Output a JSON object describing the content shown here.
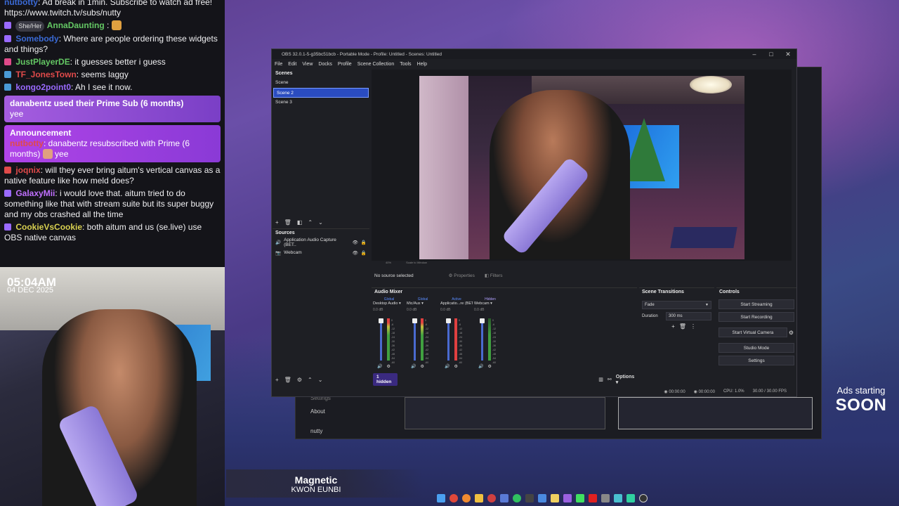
{
  "chat": {
    "top_partial": "Ad break in 1min. Subscribe to watch ad free! https://www.twitch.tv/subs/nutty",
    "top_partial_user": "nutbotty",
    "messages": [
      {
        "user": "AnnaDaunting",
        "color": "#64c864",
        "pronoun": "She/Her",
        "text": ""
      },
      {
        "user": "Somebody",
        "color": "#3a6ad6",
        "text": ": Where are people ordering these widgets and things?"
      },
      {
        "user": "JustPlayerDE",
        "color": "#64c864",
        "text": ": it guesses better i guess"
      },
      {
        "user": "TF_JonesTown",
        "color": "#e04a4a",
        "text": ": seems laggy"
      },
      {
        "user": "kongo2point0",
        "color": "#9a6aff",
        "text": ": Ah   I see it now."
      }
    ],
    "sub_notice": {
      "title": "danabentz used their Prime Sub (6 months)",
      "body": "yee"
    },
    "announcement": {
      "title": "Announcement",
      "user": "nutbotty",
      "text": ": danabentz resubscribed with Prime (6 months)",
      "tail": "yee"
    },
    "messages2": [
      {
        "user": "joqnix",
        "color": "#e04a4a",
        "text": ": will they ever bring aitum's vertical canvas as a native feature like how meld does?"
      },
      {
        "user": "GalaxyMii",
        "color": "#c070ff",
        "text": ": i would love that. aitum tried to do something like that with stream suite but its super buggy and my obs crashed all the time"
      },
      {
        "user": "CookieVsCookie",
        "color": "#d8d050",
        "text": ": both aitum and us (se.live) use OBS native canvas"
      }
    ]
  },
  "webcam": {
    "time": "05:04AM",
    "date": "04 DEC 2025"
  },
  "song": {
    "title": "Magnetic",
    "artist": "KWON EUNBI"
  },
  "ads": {
    "small": "Ads starting",
    "big": "SOON"
  },
  "bg_window": {
    "about": "About",
    "user": "nutty",
    "settings": "Settings"
  },
  "obs": {
    "title": "OBS 32.0.1-5-g35bc51bcb - Portable Mode - Profile: Untitled - Scenes: Untitled",
    "menu": [
      "File",
      "Edit",
      "View",
      "Docks",
      "Profile",
      "Scene Collection",
      "Tools",
      "Help"
    ],
    "scenes_title": "Scenes",
    "scenes": [
      "Scene",
      "Scene 2",
      "Scene 3"
    ],
    "selected_scene": "Scene 2",
    "sources_title": "Sources",
    "sources": [
      "Application Audio Capture (BET..",
      "Webcam"
    ],
    "no_source": "No source selected",
    "properties": "Properties",
    "filters": "Filters",
    "preview_zoom": "40%",
    "preview_scale": "Scale to Window",
    "mixer_title": "Audio Mixer",
    "mixer": [
      {
        "tag": "Global",
        "name": "Desktop Audio",
        "db": "0.0 dB",
        "tagColor": "#5a8cff"
      },
      {
        "tag": "Global",
        "name": "Mic/Aux",
        "db": "0.0 dB",
        "tagColor": "#5a8cff"
      },
      {
        "tag": "Active",
        "name": "Applicatio...re (BETA)",
        "db": "0.0 dB",
        "tagColor": "#5a8cff"
      },
      {
        "tag": "Hidden",
        "name": "Webcam",
        "db": "0.0 dB",
        "tagColor": "#b0a0ff"
      }
    ],
    "mixer_scale": [
      "0",
      "-6",
      "-12",
      "-18",
      "-24",
      "-30",
      "-36",
      "-42",
      "-48",
      "-54",
      "-60"
    ],
    "hidden_label": "1 hidden",
    "options_label": "Options",
    "transitions_title": "Scene Transitions",
    "transition": "Fade",
    "duration_label": "Duration",
    "duration": "300 ms",
    "controls_title": "Controls",
    "controls": [
      "Start Streaming",
      "Start Recording",
      "Start Virtual Camera",
      "Studio Mode",
      "Settings"
    ],
    "status": {
      "time1": "00:00:00",
      "time2": "00:00:00",
      "cpu": "CPU: 1.0%",
      "fps": "30.00 / 30.00 FPS"
    }
  },
  "colors": {
    "accent": "#2a4cc0",
    "chat_bg": "#141419",
    "obs_bg": "#1e1f24",
    "sub_purple": "#a55de0"
  }
}
